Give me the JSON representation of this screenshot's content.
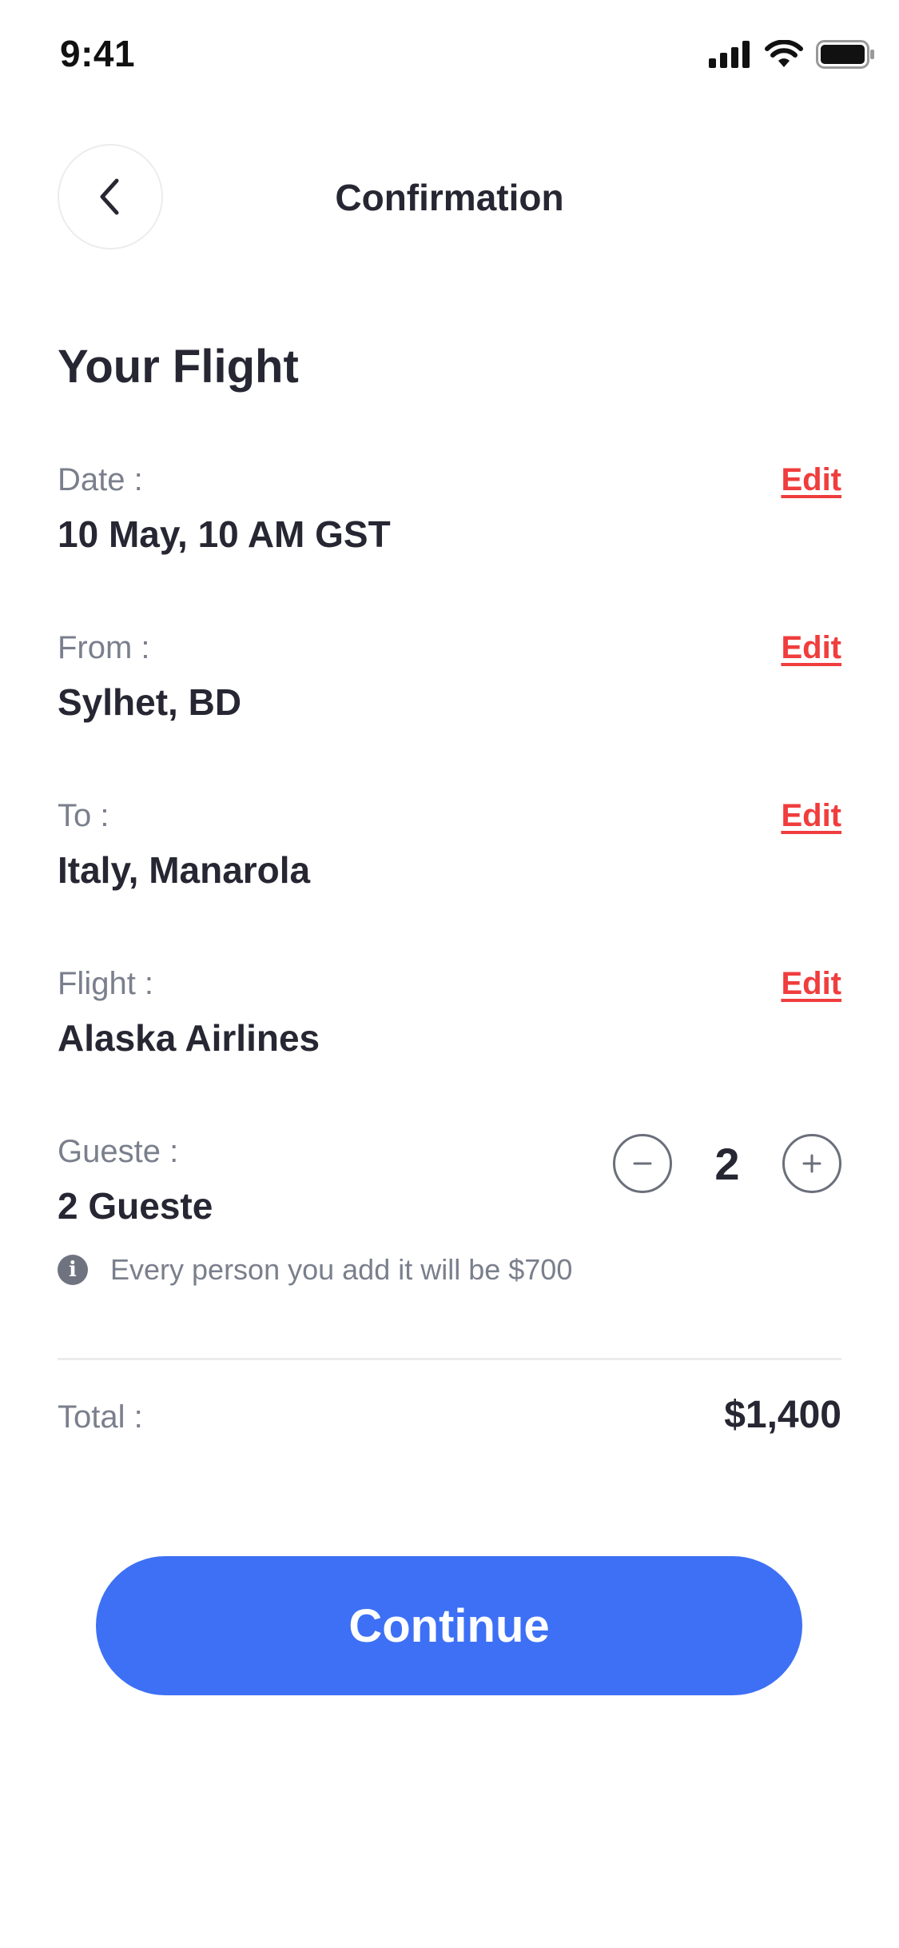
{
  "status_bar": {
    "time": "9:41",
    "icons": [
      "cellular-signal-icon",
      "wifi-icon",
      "battery-icon"
    ]
  },
  "header": {
    "title": "Confirmation",
    "back_icon": "chevron-left-icon"
  },
  "section_title": "Your Flight",
  "rows": [
    {
      "label": "Date :",
      "value": "10 May, 10 AM GST",
      "action": "Edit"
    },
    {
      "label": "From :",
      "value": "Sylhet, BD",
      "action": "Edit"
    },
    {
      "label": "To :",
      "value": "Italy, Manarola",
      "action": "Edit"
    },
    {
      "label": "Flight :",
      "value": "Alaska Airlines",
      "action": "Edit"
    }
  ],
  "guests": {
    "label": "Gueste :",
    "value": "2 Gueste",
    "count": "2",
    "decrement_icon": "minus-circle-icon",
    "increment_icon": "plus-circle-icon",
    "info_icon": "info-icon",
    "info": "Every person you add it will be $700"
  },
  "total": {
    "label": "Total :",
    "value": "$1,400"
  },
  "continue_label": "Continue",
  "colors": {
    "accent": "#3d70f5",
    "edit": "#f03d3d",
    "muted": "#7a7f8c",
    "text": "#272733"
  }
}
